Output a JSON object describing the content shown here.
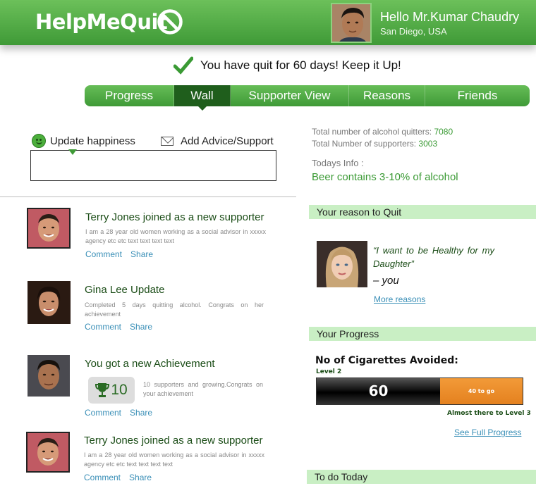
{
  "app": {
    "logo": "HelpMeQuit",
    "brand_color": "#4aa83f",
    "dark_green": "#1f5e1c",
    "link_color": "#3a8fb7"
  },
  "user": {
    "greeting": "Hello Mr.Kumar Chaudry",
    "location": "San Diego, USA"
  },
  "banner": {
    "message": "You have quit for 60 days! Keep it Up!",
    "icon": "checkmark-icon"
  },
  "nav": {
    "tabs": [
      {
        "label": "Progress",
        "active": false
      },
      {
        "label": "Wall",
        "active": true
      },
      {
        "label": "Supporter View",
        "active": false
      },
      {
        "label": "Reasons",
        "active": false
      },
      {
        "label": "Friends",
        "active": false
      }
    ]
  },
  "update": {
    "happiness_label": "Update happiness",
    "advice_label": "Add Advice/Support",
    "input_value": ""
  },
  "feed": [
    {
      "title": "Terry Jones joined as a new supporter",
      "text": "I am a 28 year old women working as a social advisor in xxxxx agency etc etc text text text text",
      "comment": "Comment",
      "share": "Share"
    },
    {
      "title": "Gina Lee Update",
      "text": "Completed 5 days quitting alcohol. Congrats on her achievement",
      "comment": "Comment",
      "share": "Share"
    },
    {
      "title": "You got a new Achievement",
      "badge_count": "10",
      "text": "10 supporters and growing.Congrats on your achievement",
      "comment": "Comment",
      "share": "Share"
    },
    {
      "title": "Terry Jones joined as a new supporter",
      "text": "I am a 28 year old women working as a social advisor in xxxxx agency etc etc text text text text",
      "comment": "Comment",
      "share": "Share"
    }
  ],
  "stats": {
    "quitters_label": "Total number of alcohol quitters:",
    "quitters_value": "7080",
    "supporters_label": "Total Number of supporters:",
    "supporters_value": "3003",
    "todays_label": "Todays Info :",
    "todays_value": "Beer contains 3-10% of alcohol"
  },
  "reason": {
    "section_title": "Your reason to Quit",
    "quote": "“I want to be Healthy for my Daughter”",
    "author": "– you",
    "more_link": "More reasons"
  },
  "progress": {
    "section_title": "Your Progress",
    "label": "No of Cigarettes Avoided:",
    "level": "Level 2",
    "value": "60",
    "remaining": "40 to go",
    "fill_fraction": 0.6,
    "almost_text": "Almost there to  Level 3",
    "full_link": "See Full Progress"
  },
  "todo": {
    "section_title": "To do Today"
  }
}
